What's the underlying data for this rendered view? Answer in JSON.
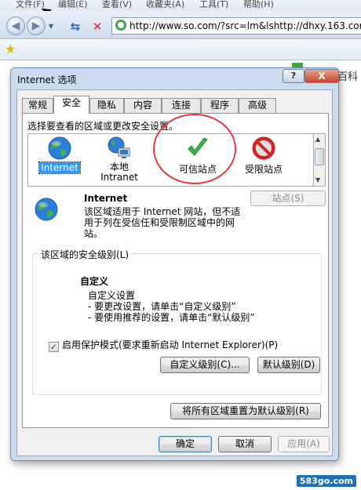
{
  "browser": {
    "menu_items": [
      "文件(F)",
      "编辑(E)",
      "查看(V)",
      "收藏夹(A)",
      "工具(T)",
      "帮助(H)"
    ],
    "address": "http://www.so.com/?src=lm&lshttp://dhxy.163.com",
    "background_text": "百科"
  },
  "dialog": {
    "title": "Internet 选项",
    "help_label": "?",
    "close_label": "X",
    "tabs": [
      "常规",
      "安全",
      "隐私",
      "内容",
      "连接",
      "程序",
      "高级"
    ],
    "active_tab": "安全",
    "zone_prompt": "选择要查看的区域或更改安全设置。",
    "zones": [
      {
        "label": "Internet",
        "icon": "globe-icon",
        "selected": true
      },
      {
        "label": "本地\nIntranet",
        "label_line1": "本地",
        "label_line2": "Intranet",
        "icon": "network-globe-icon",
        "selected": false
      },
      {
        "label": "可信站点",
        "icon": "green-check-icon",
        "selected": false
      },
      {
        "label": "受限站点",
        "icon": "red-no-entry-icon",
        "selected": false
      }
    ],
    "zone_name": "Internet",
    "zone_description": "该区域适用于 Internet 网站，但不适用于列在受信任和受限制区域中的网站。",
    "sites_button": "站点(S)",
    "security_group_label": "该区域的安全级别(L)",
    "level_title": "自定义",
    "level_lines": [
      "自定义设置",
      "- 要更改设置，请单击“自定义级别”",
      "- 要使用推荐的设置，请单击“默认级别”"
    ],
    "protected_mode_label": "启用保护模式(要求重新启动 Internet Explorer)(P)",
    "protected_mode_checked": true,
    "custom_level_button": "自定义级别(C)...",
    "default_level_button": "默认级别(D)",
    "reset_all_button": "将所有区域重置为默认级别(R)",
    "ok_button": "确定",
    "cancel_button": "取消",
    "apply_button": "应用(A)"
  },
  "watermark": "583go.com",
  "colors": {
    "selection": "#3399ff",
    "highlight_circle": "#e23a3a",
    "dialog_frame": "#cbdcef"
  }
}
